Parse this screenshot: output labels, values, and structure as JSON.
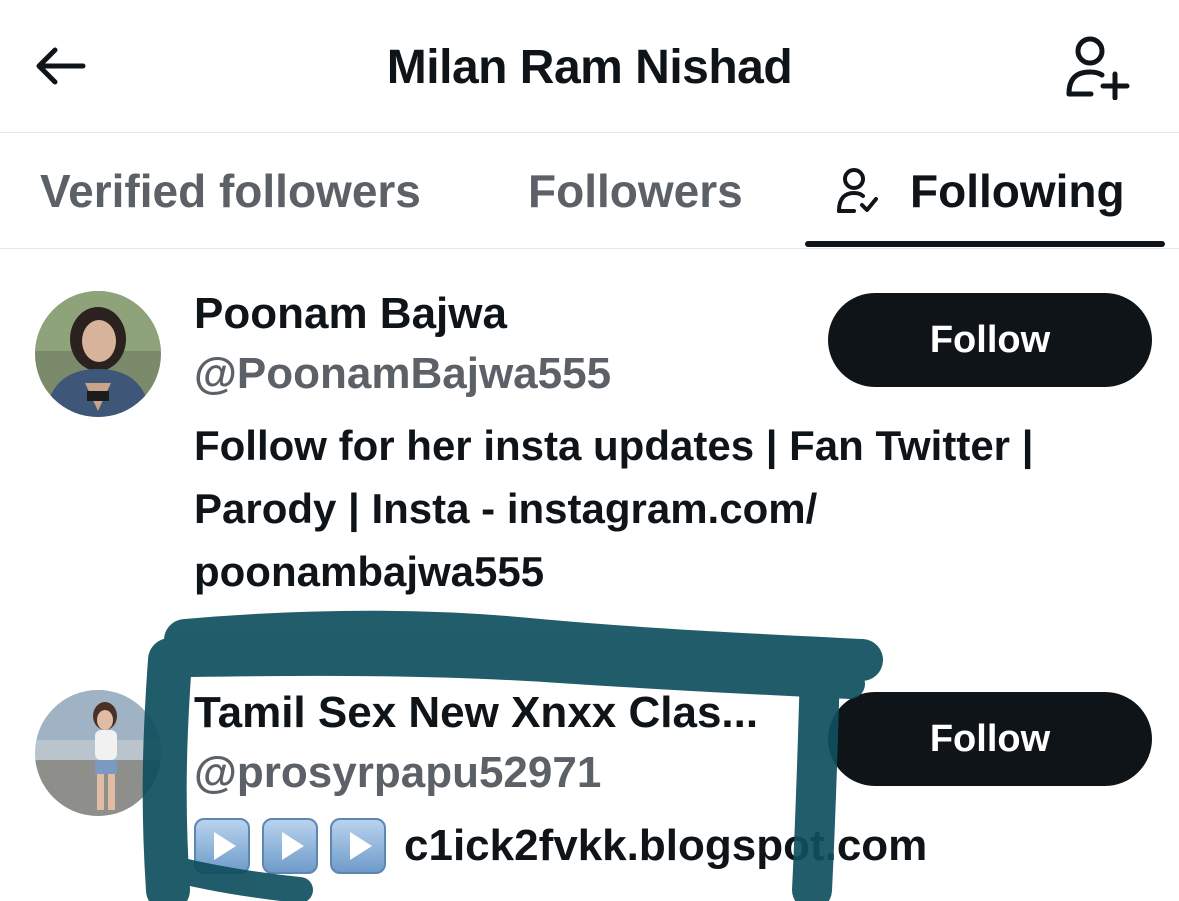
{
  "header": {
    "title": "Milan Ram Nishad",
    "back_icon": "arrow-left-icon",
    "add_icon": "add-user-icon"
  },
  "tabs": [
    {
      "label": "Verified followers",
      "active": false
    },
    {
      "label": "Followers",
      "active": false
    },
    {
      "label": "Following",
      "active": true,
      "icon": "user-check-icon"
    }
  ],
  "users": [
    {
      "name": "Poonam Bajwa",
      "handle": "@PoonamBajwa555",
      "bio_lines": [
        "Follow for her insta updates | Fan Twitter |",
        "Parody | Insta - instagram.com/",
        "poonambajwa555"
      ],
      "button": "Follow"
    },
    {
      "name": "Tamil Sex New Xnxx Clas...",
      "handle": "@prosyrpapu52971",
      "bio_icons": [
        "play-button-icon",
        "play-button-icon",
        "play-button-icon"
      ],
      "bio_url": "c1ick2fvkk.blogspot.com",
      "button": "Follow"
    }
  ],
  "colors": {
    "text": "#0f1419",
    "secondary": "#5b6167",
    "button_bg": "#0f1419",
    "button_text": "#ffffff",
    "divider": "#e6e9eb",
    "scribble": "#0f4f5e"
  }
}
